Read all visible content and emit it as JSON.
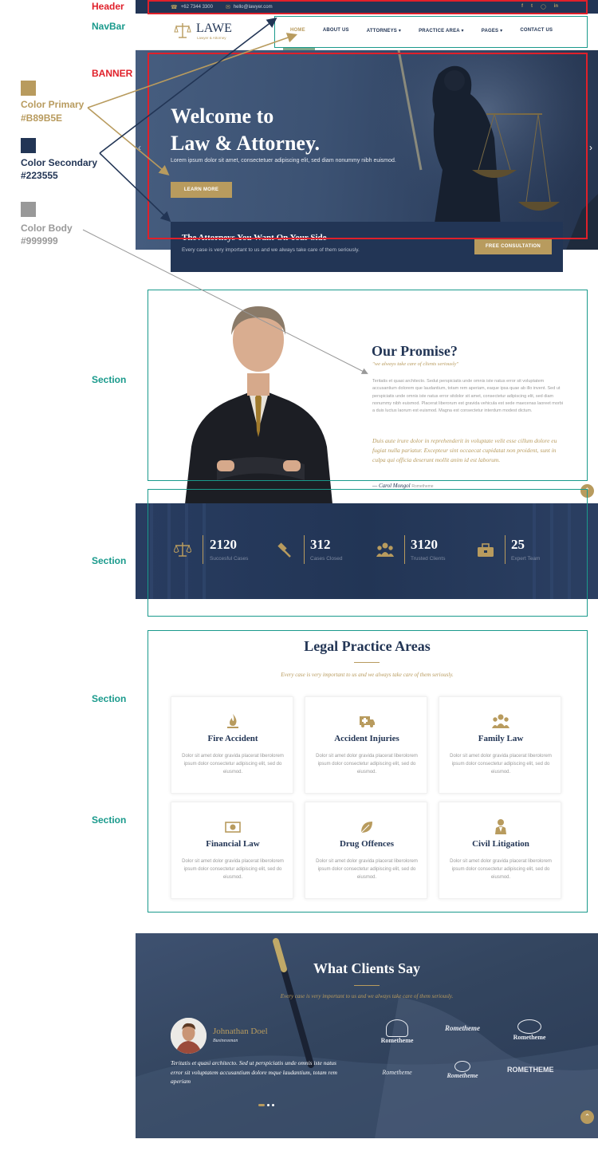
{
  "annotations": {
    "header": "Header",
    "navbar": "NavBar",
    "banner": "BANNER",
    "section": "Section",
    "colors": [
      {
        "name": "Color Primary",
        "hex": "#B89B5E",
        "swatch": "#B89B5E",
        "text_color": "#B89B5E"
      },
      {
        "name": "Color Secondary",
        "hex": "#223555",
        "swatch": "#223555",
        "text_color": "#223555"
      },
      {
        "name": "Color Body",
        "hex": "#999999",
        "swatch": "#999999",
        "text_color": "#999999"
      }
    ]
  },
  "topbar": {
    "phone": "+62 7344 3300",
    "email": "hello@lawyer.com",
    "social_icons": [
      "facebook-icon",
      "twitter-icon",
      "instagram-icon",
      "linkedin-icon"
    ]
  },
  "brand": {
    "name": "LAWE",
    "tagline": "Lawyer & Attorney"
  },
  "nav": {
    "items": [
      {
        "label": "HOME",
        "active": true
      },
      {
        "label": "ABOUT US",
        "active": false
      },
      {
        "label": "ATTORNEYS",
        "dropdown": true
      },
      {
        "label": "PRACTICE AREA",
        "dropdown": true
      },
      {
        "label": "PAGES",
        "dropdown": true
      },
      {
        "label": "CONTACT US",
        "active": false
      }
    ]
  },
  "hero": {
    "title_line1": "Welcome to",
    "title_line2": "Law & Attorney.",
    "text": "Lorem ipsum dolor sit amet, consectetuer adipiscing elit, sed diam nonummy nibh euismod.",
    "button": "LEARN MORE"
  },
  "cta": {
    "title": "The Attorneys You Want On Your Side",
    "text": "Every case is very important to us and we always take care of them seriously.",
    "button": "FREE CONSULTATION"
  },
  "promise": {
    "title": "Our Promise?",
    "subtitle": "\"we always take care of clients seriously\"",
    "body": "Teritatis et quasi architecto. Sedut perspiciatis unde omnis iste natus error sit voluptatem accusantium dolorem que laudantium, totam rem aperiam, eaque ipsa quae ab illo invent. Sed ut perspiciatis unde omnis iste natus error sitdolor sit amet, consectetur adipiscing elit, sed diam nonummy nibh euismod. Placerat liberorum est gravida vehicula est sede maecenas laoreet morbi a duis luctus laorum est euismod. Magna est consectetur interdum modest dictum.",
    "quote": "Duis aute irure dolor in reprehenderit in voluptate velit esse cillum dolore eu fugiat nulla pariatur. Excepteur sint occaecat cupidatat non proident, sunt in culpa qui officia deserunt mollit anim id est laborum.",
    "author": "— Carol Mongol",
    "author_company": "Rometheme"
  },
  "stats": [
    {
      "value": "2120",
      "label": "Succesful Cases",
      "icon": "scales-icon"
    },
    {
      "value": "312",
      "label": "Cases Closed",
      "icon": "gavel-icon"
    },
    {
      "value": "3120",
      "label": "Trusted Clients",
      "icon": "users-icon"
    },
    {
      "value": "25",
      "label": "Expert Team",
      "icon": "briefcase-icon"
    }
  ],
  "practice": {
    "title": "Legal Practice Areas",
    "subtitle": "Every case is very important to us and we always take care of them seriously.",
    "cards": [
      {
        "title": "Fire Accident",
        "icon": "fire-icon",
        "text": "Dolor sit amet dolor gravida placerat liberolorem ipsum dolor consectetur adipiscing elit, sed do eiusmod."
      },
      {
        "title": "Accident Injuries",
        "icon": "ambulance-icon",
        "text": "Dolor sit amet dolor gravida placerat liberolorem ipsum dolor consectetur adipiscing elit, sed do eiusmod."
      },
      {
        "title": "Family Law",
        "icon": "family-icon",
        "text": "Dolor sit amet dolor gravida placerat liberolorem ipsum dolor consectetur adipiscing elit, sed do eiusmod."
      },
      {
        "title": "Financial Law",
        "icon": "money-icon",
        "text": "Dolor sit amet dolor gravida placerat liberolorem ipsum dolor consectetur adipiscing elit, sed do eiusmod."
      },
      {
        "title": "Drug Offences",
        "icon": "leaf-icon",
        "text": "Dolor sit amet dolor gravida placerat liberolorem ipsum dolor consectetur adipiscing elit, sed do eiusmod."
      },
      {
        "title": "Civil Litigation",
        "icon": "lawyer-icon",
        "text": "Dolor sit amet dolor gravida placerat liberolorem ipsum dolor consectetur adipiscing elit, sed do eiusmod."
      }
    ]
  },
  "testimonials": {
    "title": "What Clients Say",
    "subtitle": "Every case is very important to us and we always take care of them seriously.",
    "name": "Johnathan Doel",
    "role": "Businessman",
    "text": "Teritatis et quasi architecto. Sed ut perspiciatis unde omnis iste natus error sit voluptatem accusantium dolore mque laudantium, totam rem aperiam",
    "logos": [
      "Rometheme",
      "Rometheme",
      "Rometheme",
      "Rometheme",
      "Rometheme",
      "ROMETHEME"
    ]
  }
}
